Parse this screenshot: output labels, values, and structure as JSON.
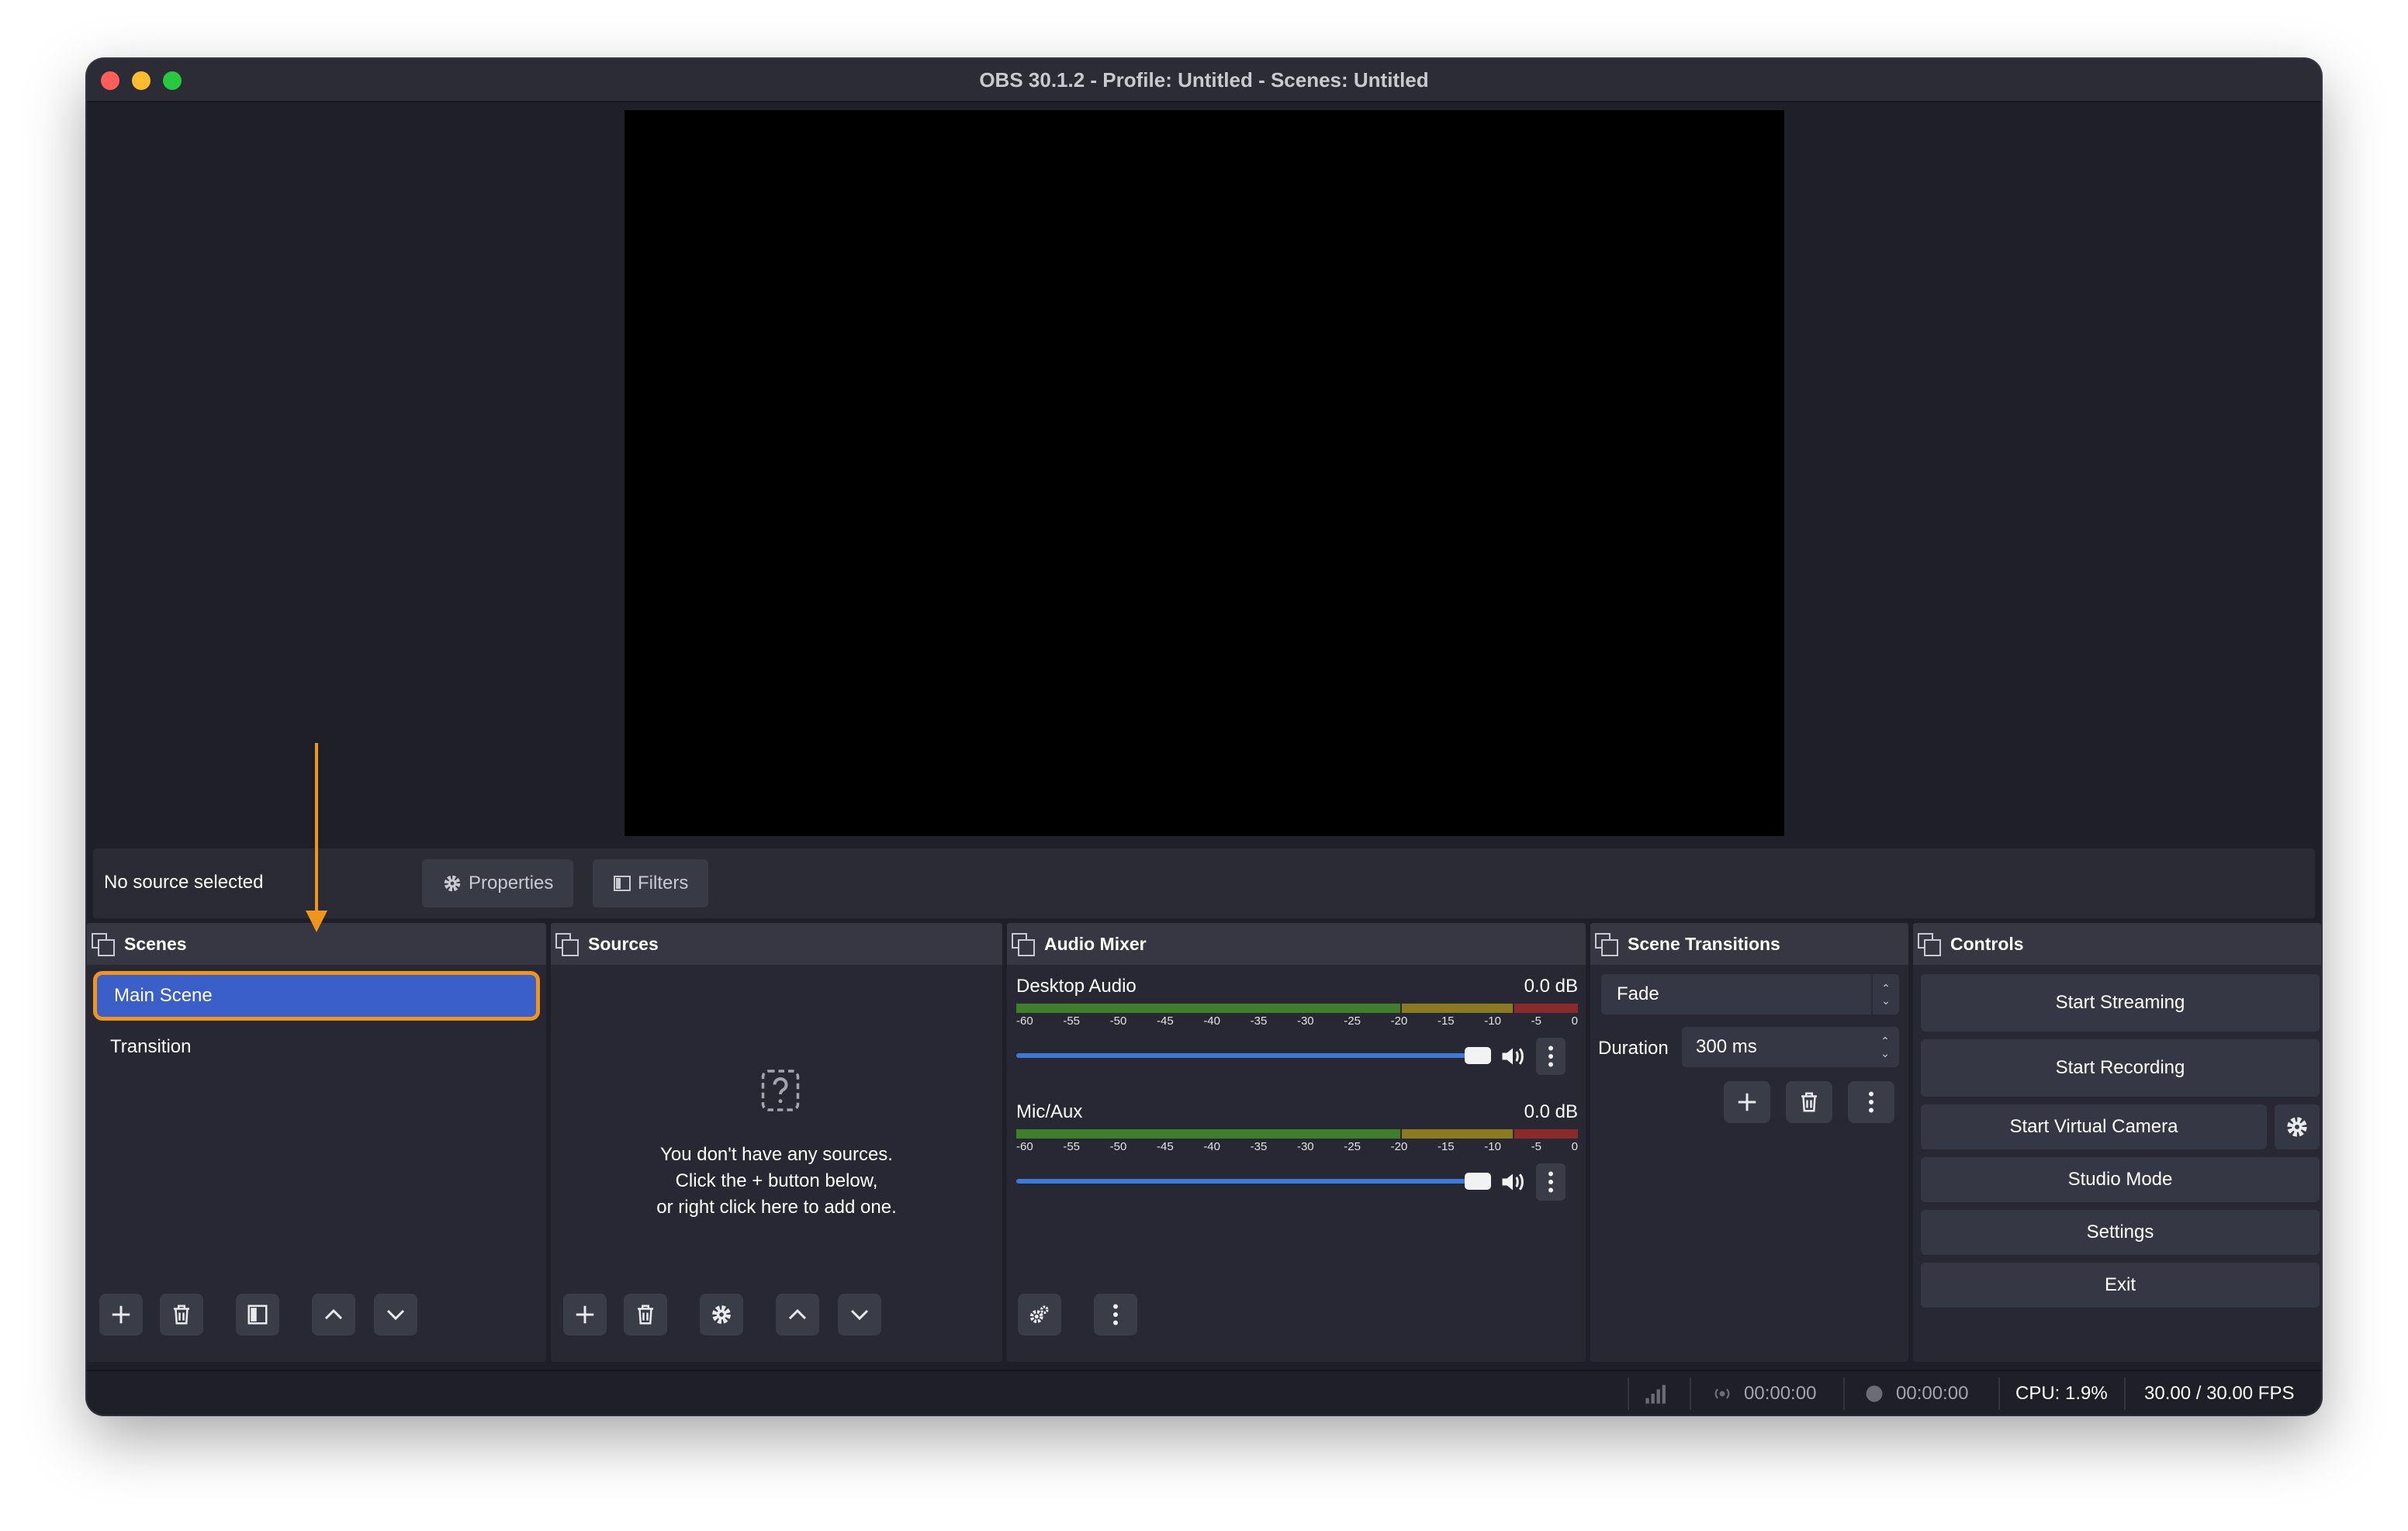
{
  "window": {
    "title": "OBS 30.1.2 - Profile: Untitled - Scenes: Untitled"
  },
  "context_bar": {
    "no_source_label": "No source selected",
    "properties_label": "Properties",
    "filters_label": "Filters"
  },
  "scenes": {
    "title": "Scenes",
    "items": [
      {
        "label": "Main Scene",
        "selected": true
      },
      {
        "label": "Transition",
        "selected": false
      }
    ]
  },
  "sources": {
    "title": "Sources",
    "empty_line1": "You don't have any sources.",
    "empty_line2": "Click the + button below,",
    "empty_line3": "or right click here to add one."
  },
  "audio_mixer": {
    "title": "Audio Mixer",
    "ticks": [
      "-60",
      "-55",
      "-50",
      "-45",
      "-40",
      "-35",
      "-30",
      "-25",
      "-20",
      "-15",
      "-10",
      "-5",
      "0"
    ],
    "channels": [
      {
        "name": "Desktop Audio",
        "level": "0.0 dB"
      },
      {
        "name": "Mic/Aux",
        "level": "0.0 dB"
      }
    ]
  },
  "scene_transitions": {
    "title": "Scene Transitions",
    "selected_transition": "Fade",
    "duration_label": "Duration",
    "duration_value": "300 ms"
  },
  "controls": {
    "title": "Controls",
    "start_streaming": "Start Streaming",
    "start_recording": "Start Recording",
    "start_virtual_camera": "Start Virtual Camera",
    "studio_mode": "Studio Mode",
    "settings": "Settings",
    "exit": "Exit"
  },
  "status_bar": {
    "stream_time": "00:00:00",
    "record_time": "00:00:00",
    "cpu": "CPU: 1.9%",
    "fps": "30.00 / 30.00 FPS"
  },
  "colors": {
    "accent_selected": "#3b5fc8",
    "annotation_orange": "#f0951b",
    "fader_blue": "#3c79db"
  }
}
